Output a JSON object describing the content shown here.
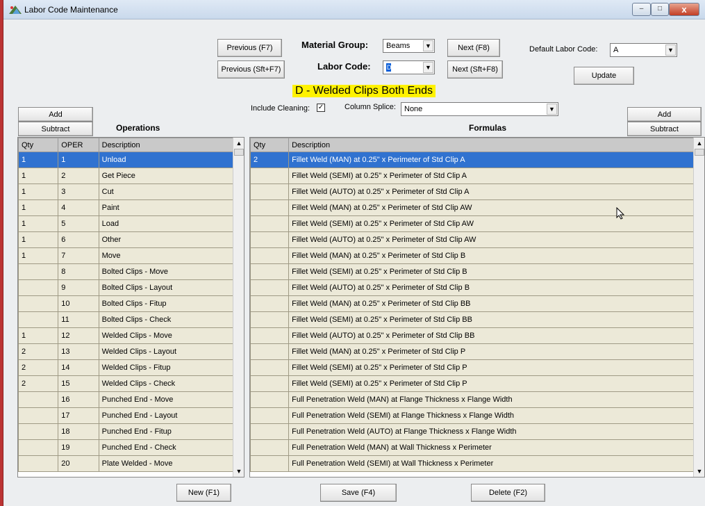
{
  "window": {
    "title": "Labor Code Maintenance",
    "controls": {
      "minimize": "–",
      "maximize": "□",
      "close": "x"
    }
  },
  "header": {
    "prev_f7": "Previous (F7)",
    "prev_sft_f7": "Previous (Sft+F7)",
    "material_group_label": "Material Group:",
    "material_group_value": "Beams",
    "labor_code_label": "Labor Code:",
    "labor_code_value": "D",
    "next_f8": "Next (F8)",
    "next_sft_f8": "Next (Sft+F8)",
    "default_labor_code_label": "Default Labor Code:",
    "default_labor_code_value": "A",
    "update": "Update",
    "headline": "D - Welded Clips Both Ends",
    "include_cleaning_label": "Include Cleaning:",
    "include_cleaning_mark": "✓",
    "column_splice_label": "Column Splice:",
    "column_splice_value": "None"
  },
  "operations": {
    "add": "Add",
    "subtract": "Subtract",
    "title": "Operations",
    "columns": [
      "Qty",
      "OPER",
      "Description"
    ],
    "rows": [
      {
        "qty": "1",
        "oper": "1",
        "desc": "Unload"
      },
      {
        "qty": "1",
        "oper": "2",
        "desc": "Get Piece"
      },
      {
        "qty": "1",
        "oper": "3",
        "desc": "Cut"
      },
      {
        "qty": "1",
        "oper": "4",
        "desc": "Paint"
      },
      {
        "qty": "1",
        "oper": "5",
        "desc": "Load"
      },
      {
        "qty": "1",
        "oper": "6",
        "desc": "Other"
      },
      {
        "qty": "1",
        "oper": "7",
        "desc": "Move"
      },
      {
        "qty": "",
        "oper": "8",
        "desc": "Bolted Clips - Move"
      },
      {
        "qty": "",
        "oper": "9",
        "desc": "Bolted Clips - Layout"
      },
      {
        "qty": "",
        "oper": "10",
        "desc": "Bolted Clips - Fitup"
      },
      {
        "qty": "",
        "oper": "11",
        "desc": "Bolted Clips - Check"
      },
      {
        "qty": "1",
        "oper": "12",
        "desc": "Welded Clips - Move"
      },
      {
        "qty": "2",
        "oper": "13",
        "desc": "Welded Clips - Layout"
      },
      {
        "qty": "2",
        "oper": "14",
        "desc": "Welded Clips - Fitup"
      },
      {
        "qty": "2",
        "oper": "15",
        "desc": "Welded Clips - Check"
      },
      {
        "qty": "",
        "oper": "16",
        "desc": "Punched End - Move"
      },
      {
        "qty": "",
        "oper": "17",
        "desc": "Punched End - Layout"
      },
      {
        "qty": "",
        "oper": "18",
        "desc": "Punched End - Fitup"
      },
      {
        "qty": "",
        "oper": "19",
        "desc": "Punched End - Check"
      },
      {
        "qty": "",
        "oper": "20",
        "desc": "Plate Welded - Move"
      }
    ]
  },
  "formulas": {
    "add": "Add",
    "subtract": "Subtract",
    "title": "Formulas",
    "columns": [
      "Qty",
      "Description"
    ],
    "rows": [
      {
        "qty": "2",
        "desc": "Fillet Weld (MAN) at 0.25\" x Perimeter of Std Clip A"
      },
      {
        "qty": "",
        "desc": "Fillet Weld (SEMI) at 0.25\" x Perimeter of Std Clip A"
      },
      {
        "qty": "",
        "desc": "Fillet Weld (AUTO) at 0.25\" x Perimeter of Std Clip A"
      },
      {
        "qty": "",
        "desc": "Fillet Weld (MAN) at 0.25\" x Perimeter of Std Clip AW"
      },
      {
        "qty": "",
        "desc": "Fillet Weld (SEMI) at 0.25\" x Perimeter of Std Clip AW"
      },
      {
        "qty": "",
        "desc": "Fillet Weld (AUTO) at 0.25\" x Perimeter of Std Clip AW"
      },
      {
        "qty": "",
        "desc": "Fillet Weld (MAN) at 0.25\" x Perimeter of Std Clip B"
      },
      {
        "qty": "",
        "desc": "Fillet Weld (SEMI) at 0.25\" x Perimeter of Std Clip B"
      },
      {
        "qty": "",
        "desc": "Fillet Weld (AUTO) at 0.25\" x Perimeter of Std Clip B"
      },
      {
        "qty": "",
        "desc": "Fillet Weld (MAN) at 0.25\" x Perimeter of Std Clip BB"
      },
      {
        "qty": "",
        "desc": "Fillet Weld (SEMI) at 0.25\" x Perimeter of Std Clip BB"
      },
      {
        "qty": "",
        "desc": "Fillet Weld (AUTO) at 0.25\" x Perimeter of Std Clip BB"
      },
      {
        "qty": "",
        "desc": "Fillet Weld (MAN) at 0.25\" x Perimeter of Std Clip P"
      },
      {
        "qty": "",
        "desc": "Fillet Weld (SEMI) at 0.25\" x Perimeter of Std Clip P"
      },
      {
        "qty": "",
        "desc": "Fillet Weld (SEMI) at 0.25\" x Perimeter of Std Clip P"
      },
      {
        "qty": "",
        "desc": "Full Penetration Weld (MAN) at Flange Thickness x Flange Width"
      },
      {
        "qty": "",
        "desc": "Full Penetration Weld (SEMI) at Flange Thickness x Flange Width"
      },
      {
        "qty": "",
        "desc": "Full Penetration Weld (AUTO) at Flange Thickness x Flange Width"
      },
      {
        "qty": "",
        "desc": "Full Penetration Weld (MAN) at Wall Thickness x Perimeter"
      },
      {
        "qty": "",
        "desc": "Full Penetration Weld (SEMI) at Wall Thickness x Perimeter"
      }
    ]
  },
  "footer": {
    "new": "New (F1)",
    "save": "Save (F4)",
    "delete": "Delete (F2)"
  },
  "icons": {
    "app": "labor-code-app-icon",
    "dropdown": "dropdown-arrow-icon",
    "scroll_up": "scroll-up-icon",
    "scroll_down": "scroll-down-icon",
    "cursor": "mouse-pointer-icon"
  },
  "colors": {
    "selection": "#3072d0",
    "highlight": "#fff200",
    "row_bg": "#ece9d8"
  }
}
